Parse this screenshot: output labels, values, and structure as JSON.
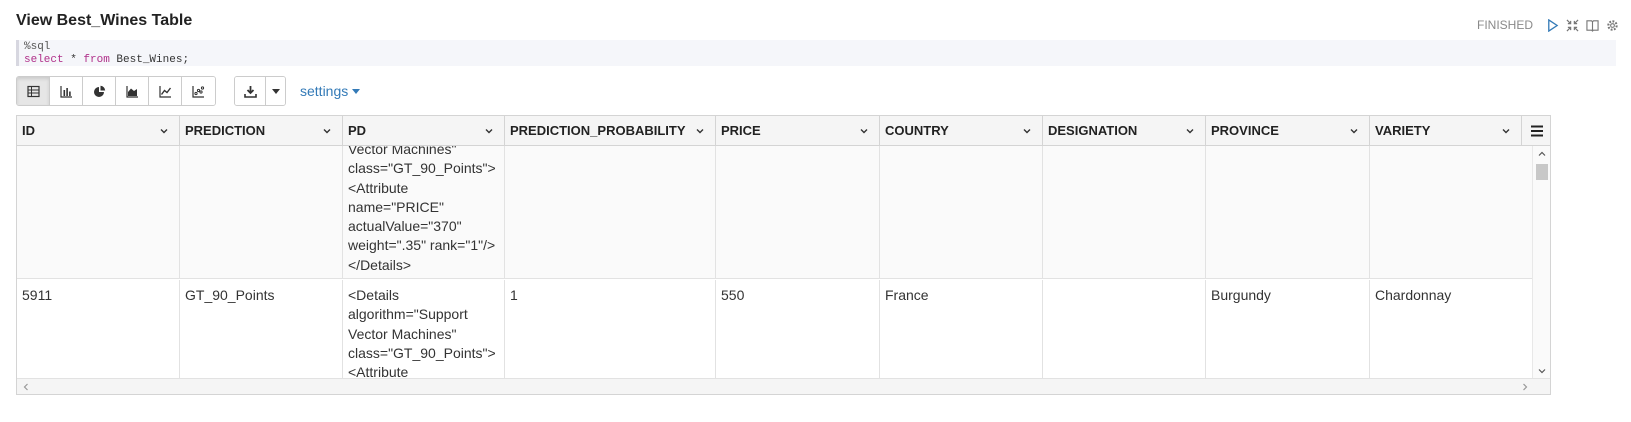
{
  "paragraph": {
    "title": "View Best_Wines Table",
    "status": "FINISHED"
  },
  "editor": {
    "line1": "%sql",
    "kw_select": "select",
    "star": " * ",
    "kw_from": "from",
    "table_name": " Best_Wines;"
  },
  "toolbar": {
    "viz_buttons": [
      "table-icon",
      "bar-chart-icon",
      "pie-chart-icon",
      "area-chart-icon",
      "line-chart-icon",
      "scatter-chart-icon"
    ],
    "settings_label": "settings"
  },
  "table": {
    "columns": [
      "ID",
      "PREDICTION",
      "PD",
      "PREDICTION_PROBABILITY",
      "PRICE",
      "COUNTRY",
      "DESIGNATION",
      "PROVINCE",
      "VARIETY"
    ],
    "rows": [
      {
        "id": "",
        "prediction": "",
        "pd": "Vector Machines\"\nclass=\"GT_90_Points\">\n<Attribute\nname=\"PRICE\"\nactualValue=\"370\"\nweight=\".35\" rank=\"1\"/>\n</Details>",
        "prediction_probability": "",
        "price": "",
        "country": "",
        "designation": "",
        "province": "",
        "variety": ""
      },
      {
        "id": "5911",
        "prediction": "GT_90_Points",
        "pd": "<Details\nalgorithm=\"Support\nVector Machines\"\nclass=\"GT_90_Points\">\n<Attribute",
        "prediction_probability": "1",
        "price": "550",
        "country": "France",
        "designation": "",
        "province": "Burgundy",
        "variety": "Chardonnay"
      }
    ]
  },
  "colors": {
    "link": "#337ab7",
    "keyword": "#b0308a",
    "header_bg": "#f5f5f5"
  }
}
